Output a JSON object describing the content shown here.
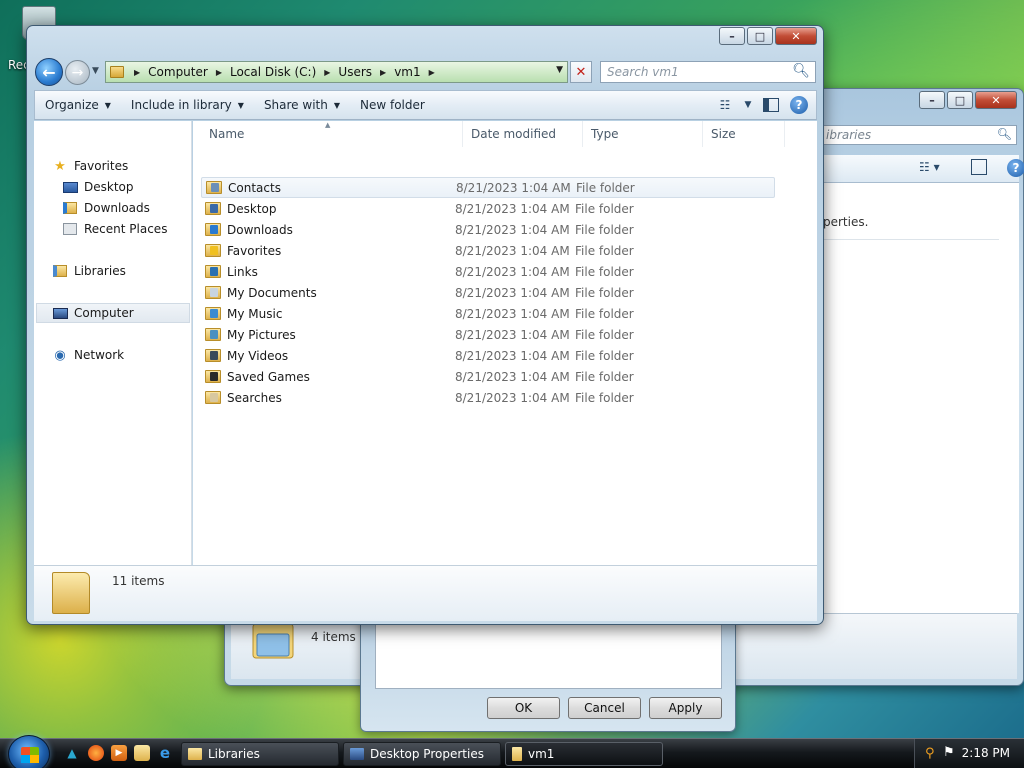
{
  "desktop": {
    "recycle_label": "Rec"
  },
  "back_window": {
    "search_placeholder": "Search Libraries",
    "search_visible": "ibraries",
    "content_text": "perties.",
    "status_text": "4 items"
  },
  "dialog": {
    "ok": "OK",
    "cancel": "Cancel",
    "apply": "Apply"
  },
  "window": {
    "caption": {
      "minimize": "–",
      "maximize": "□",
      "close": "✕"
    },
    "address": [
      "Computer",
      "Local Disk (C:)",
      "Users",
      "vm1"
    ],
    "search_placeholder": "Search vm1",
    "toolbar": {
      "organize": "Organize",
      "include": "Include in library",
      "share": "Share with",
      "new_folder": "New folder"
    },
    "nav": {
      "favorites": "Favorites",
      "desktop": "Desktop",
      "downloads": "Downloads",
      "recent": "Recent Places",
      "libraries": "Libraries",
      "computer": "Computer",
      "network": "Network"
    },
    "columns": {
      "name": "Name",
      "date": "Date modified",
      "type": "Type",
      "size": "Size"
    },
    "files": [
      {
        "name": "Contacts",
        "date": "8/21/2023 1:04 AM",
        "type": "File folder",
        "badge": "#6a8fb8"
      },
      {
        "name": "Desktop",
        "date": "8/21/2023 1:04 AM",
        "type": "File folder",
        "badge": "#3a6aa8"
      },
      {
        "name": "Downloads",
        "date": "8/21/2023 1:04 AM",
        "type": "File folder",
        "badge": "#2a7ad0"
      },
      {
        "name": "Favorites",
        "date": "8/21/2023 1:04 AM",
        "type": "File folder",
        "badge": "#f0c020"
      },
      {
        "name": "Links",
        "date": "8/21/2023 1:04 AM",
        "type": "File folder",
        "badge": "#2a70b0"
      },
      {
        "name": "My Documents",
        "date": "8/21/2023 1:04 AM",
        "type": "File folder",
        "badge": "#c8d4e0"
      },
      {
        "name": "My Music",
        "date": "8/21/2023 1:04 AM",
        "type": "File folder",
        "badge": "#3a8ad0"
      },
      {
        "name": "My Pictures",
        "date": "8/21/2023 1:04 AM",
        "type": "File folder",
        "badge": "#4a90c0"
      },
      {
        "name": "My Videos",
        "date": "8/21/2023 1:04 AM",
        "type": "File folder",
        "badge": "#3a4a5a"
      },
      {
        "name": "Saved Games",
        "date": "8/21/2023 1:04 AM",
        "type": "File folder",
        "badge": "#2a2a2a"
      },
      {
        "name": "Searches",
        "date": "8/21/2023 1:04 AM",
        "type": "File folder",
        "badge": "#d8c8a0"
      }
    ],
    "status": "11 items"
  },
  "taskbar": {
    "tasks": [
      "Libraries",
      "Desktop Properties",
      "vm1"
    ],
    "clock": "2:18 PM"
  }
}
